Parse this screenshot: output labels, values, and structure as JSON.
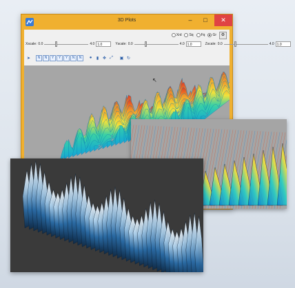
{
  "window": {
    "title": "3D Plots",
    "min_glyph": "–",
    "max_glyph": "□",
    "close_glyph": "✕"
  },
  "radios": [
    {
      "label": "Xrd",
      "checked": false
    },
    {
      "label": "Sq",
      "checked": false
    },
    {
      "label": "Fq",
      "checked": false
    },
    {
      "label": "Gr",
      "checked": true
    }
  ],
  "gear_glyph": "⚙",
  "scales": [
    {
      "label": "Xscale:",
      "min": "0.0",
      "max": "4.0",
      "value": "1.0",
      "thumb_fraction": 0.25
    },
    {
      "label": "Yscale:",
      "min": "0.0",
      "max": "4.0",
      "value": "1.0",
      "thumb_fraction": 0.25
    },
    {
      "label": "Zscale:",
      "min": "0.0",
      "max": "4.0",
      "value": "1.0",
      "thumb_fraction": 0.25
    }
  ],
  "toolbar": [
    {
      "name": "pointer-icon",
      "glyph": "➤"
    },
    {
      "name": "view-front-icon",
      "glyph": "N"
    },
    {
      "name": "view-back-icon",
      "glyph": "N"
    },
    {
      "name": "view-left-icon",
      "glyph": "Y"
    },
    {
      "name": "view-right-icon",
      "glyph": "Y"
    },
    {
      "name": "view-top-icon",
      "glyph": "Y"
    },
    {
      "name": "view-bottom-icon",
      "glyph": "N"
    },
    {
      "name": "view-iso-icon",
      "glyph": "N"
    },
    {
      "name": "sphere-icon",
      "glyph": "●"
    },
    {
      "name": "cylinder-icon",
      "glyph": "▮"
    },
    {
      "name": "axes-icon",
      "glyph": "✥"
    },
    {
      "name": "fit-view-icon",
      "glyph": "⤢"
    },
    {
      "name": "save-icon",
      "glyph": "▣"
    },
    {
      "name": "rotate-icon",
      "glyph": "↻"
    }
  ]
}
